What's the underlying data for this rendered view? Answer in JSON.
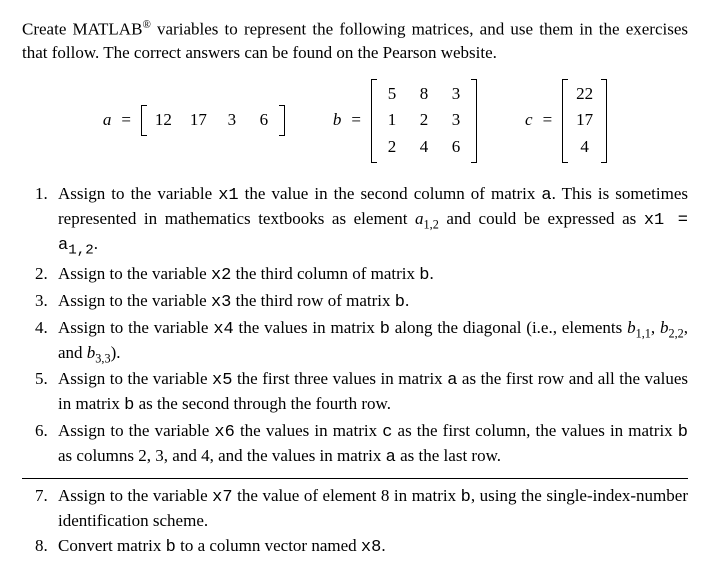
{
  "intro_part1": "Create MATLAB",
  "intro_reg": "®",
  "intro_part2": " variables to represent the following matrices, and use them in the exercises that follow. The correct answers can be found on the Pearson website.",
  "mats": {
    "a_name": "a",
    "a": [
      "12",
      "17",
      "3",
      "6"
    ],
    "b_name": "b",
    "b": [
      "5",
      "8",
      "3",
      "1",
      "2",
      "3",
      "2",
      "4",
      "6"
    ],
    "c_name": "c",
    "c": [
      "22",
      "17",
      "4"
    ],
    "eq": "="
  },
  "chart_data": {
    "type": "table",
    "matrices": {
      "a": {
        "rows": 1,
        "cols": 4,
        "values": [
          [
            12,
            17,
            3,
            6
          ]
        ]
      },
      "b": {
        "rows": 3,
        "cols": 3,
        "values": [
          [
            5,
            8,
            3
          ],
          [
            1,
            2,
            3
          ],
          [
            2,
            4,
            6
          ]
        ]
      },
      "c": {
        "rows": 3,
        "cols": 1,
        "values": [
          [
            22
          ],
          [
            17
          ],
          [
            4
          ]
        ]
      }
    }
  },
  "q": {
    "1a": "Assign to the variable ",
    "1b": " the value in the second column of matrix ",
    "1c": ". This is sometimes represented in mathematics textbooks as element ",
    "1d": " and could be expressed as ",
    "1e": ".",
    "x1": "x1",
    "a": "a",
    "a12_sub": "a",
    "a12_subscript": "1,2",
    "x1eq": "x1 = a",
    "x1eq_sub": "1,2",
    "2a": "Assign to the variable ",
    "2b": " the third column of matrix ",
    "2c": ".",
    "x2": "x2",
    "b": "b",
    "3a": "Assign to the variable ",
    "3b": " the third row of matrix ",
    "3c": ".",
    "x3": "x3",
    "4a": "Assign to the variable ",
    "4b": " the values in matrix ",
    "4c": " along the diagonal (i.e., elements ",
    "4d": ", ",
    "4e": ", and ",
    "4f": ").",
    "x4": "x4",
    "b11": "b",
    "b11s": "1,1",
    "b22": "b",
    "b22s": "2,2",
    "b33": "b",
    "b33s": "3,3",
    "5a": "Assign to the variable ",
    "5b": " the first three values in matrix ",
    "5c": " as the first row and all the values in matrix ",
    "5d": " as the second through the fourth row.",
    "x5": "x5",
    "6a": "Assign to the variable ",
    "6b": " the values in matrix ",
    "6c": " as the first column, the values in matrix ",
    "6d": " as columns 2, 3, and 4, and the values in matrix ",
    "6e": " as the last row.",
    "x6": "x6",
    "mc": "c",
    "7a": "Assign to the variable ",
    "7b": " the value of element 8 in matrix ",
    "7c": ", using the single-index-number identification scheme.",
    "x7": "x7",
    "8a": "Convert matrix ",
    "8b": " to a column vector named ",
    "8c": ".",
    "x8": "x8"
  }
}
